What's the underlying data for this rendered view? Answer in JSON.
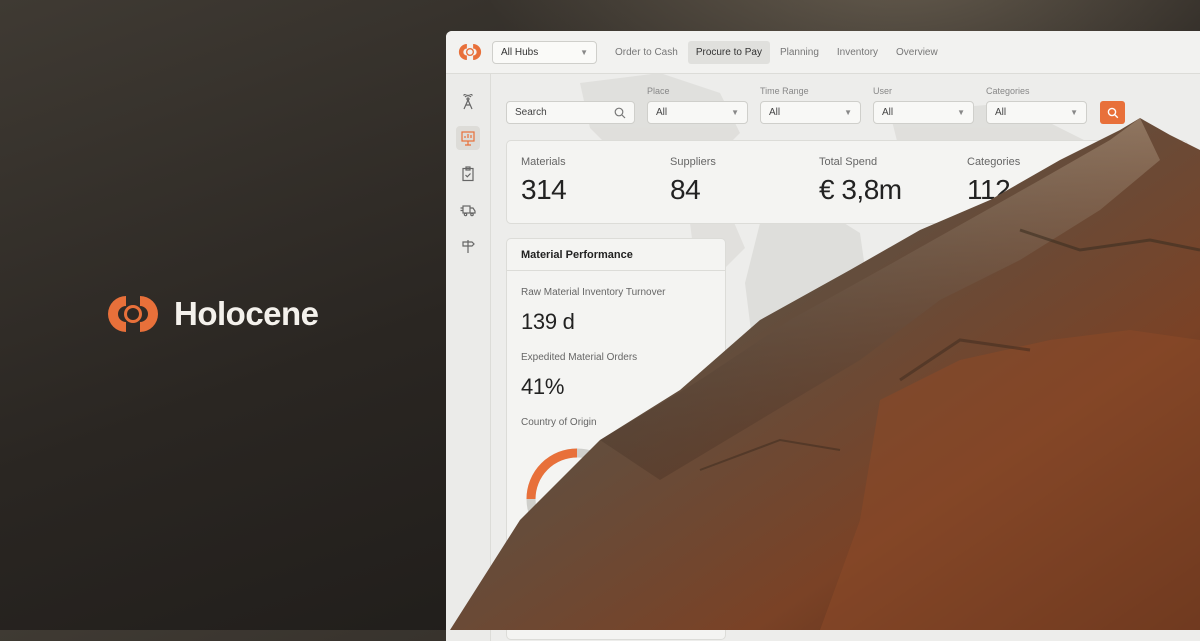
{
  "brand": {
    "name": "Holocene"
  },
  "colors": {
    "accent": "#e8703a",
    "background_dark": "#2a2622",
    "panel": "#ededeb"
  },
  "topbar": {
    "hub_select": {
      "value": "All Hubs"
    },
    "tabs": [
      {
        "label": "Order to Cash",
        "active": false
      },
      {
        "label": "Procure to Pay",
        "active": true
      },
      {
        "label": "Planning",
        "active": false
      },
      {
        "label": "Inventory",
        "active": false
      },
      {
        "label": "Overview",
        "active": false
      }
    ]
  },
  "sidebar": {
    "items": [
      {
        "icon": "antenna-tower-icon",
        "active": false
      },
      {
        "icon": "presentation-chart-icon",
        "active": true
      },
      {
        "icon": "clipboard-check-icon",
        "active": false
      },
      {
        "icon": "delivery-truck-icon",
        "active": false
      },
      {
        "icon": "signpost-icon",
        "active": false
      }
    ]
  },
  "filters": {
    "search_placeholder": "Search",
    "place": {
      "label": "Place",
      "value": "All"
    },
    "time_range": {
      "label": "Time Range",
      "value": "All"
    },
    "user": {
      "label": "User",
      "value": "All"
    },
    "categories": {
      "label": "Categories",
      "value": "All"
    }
  },
  "kpis": [
    {
      "label": "Materials",
      "value": "314"
    },
    {
      "label": "Suppliers",
      "value": "84"
    },
    {
      "label": "Total Spend",
      "value": "€ 3,8m"
    },
    {
      "label": "Categories",
      "value": "112"
    }
  ],
  "material_performance": {
    "title": "Material Performance",
    "metrics": [
      {
        "label": "Raw Material Inventory Turnover",
        "value": "139 d"
      },
      {
        "label": "Expedited Material Orders",
        "value": "41%"
      }
    ],
    "country_of_origin": {
      "label": "Country of Origin",
      "highlight_fraction": 0.25
    }
  }
}
